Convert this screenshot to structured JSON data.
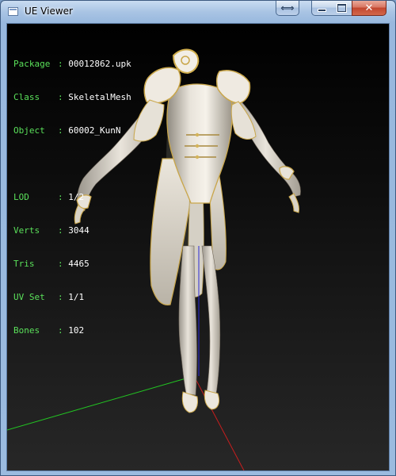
{
  "window": {
    "title": "UE Viewer",
    "icons": {
      "app": "window-icon",
      "extra": "swap-arrows-icon",
      "minimize": "minimize-icon",
      "maximize": "maximize-icon",
      "close": "close-icon"
    },
    "glyphs": {
      "extra": "⟺",
      "close": "✕"
    }
  },
  "info": {
    "package": {
      "key": "Package",
      "value": "00012862.upk"
    },
    "class": {
      "key": "Class",
      "value": "SkeletalMesh"
    },
    "object": {
      "key": "Object",
      "value": "60002_KunN"
    },
    "lod": {
      "key": "LOD",
      "value": "1/2"
    },
    "verts": {
      "key": "Verts",
      "value": "3044"
    },
    "tris": {
      "key": "Tris",
      "value": "4465"
    },
    "uvset": {
      "key": "UV Set",
      "value": "1/1"
    },
    "bones": {
      "key": "Bones",
      "value": "102"
    }
  },
  "colors": {
    "info_label": "#5ae05a",
    "info_value": "#ffffff",
    "axis_x": "#c81e1e",
    "axis_y": "#22c422",
    "axis_z": "#2a2ad8",
    "viewport_bg_top": "#000000",
    "viewport_bg_bottom": "#272727"
  }
}
